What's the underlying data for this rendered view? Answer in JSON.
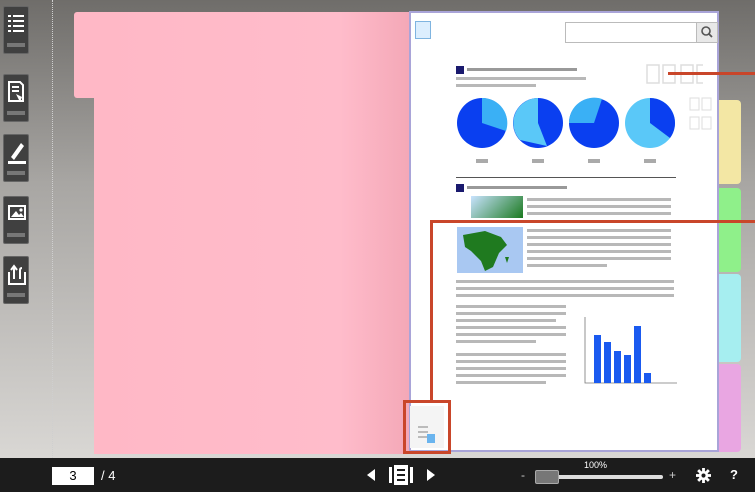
{
  "toolbar": {
    "items": [
      {
        "icon": "table-of-contents-icon"
      },
      {
        "icon": "bookmark-icon"
      },
      {
        "icon": "highlighter-icon"
      },
      {
        "icon": "image-icon"
      },
      {
        "icon": "export-icon"
      }
    ]
  },
  "viewer": {
    "current_page": "3",
    "total_pages": "/ 4",
    "zoom": "100%",
    "zoom_minus": "-",
    "zoom_plus": "+",
    "help": "?"
  },
  "colors": {
    "accent_callout": "#c9462a",
    "left_page": "#ffb8c6",
    "tabs": [
      "#f3e7a4",
      "#8ff08a",
      "#8cf08e",
      "#a6eef0",
      "#e9a6e2"
    ]
  }
}
